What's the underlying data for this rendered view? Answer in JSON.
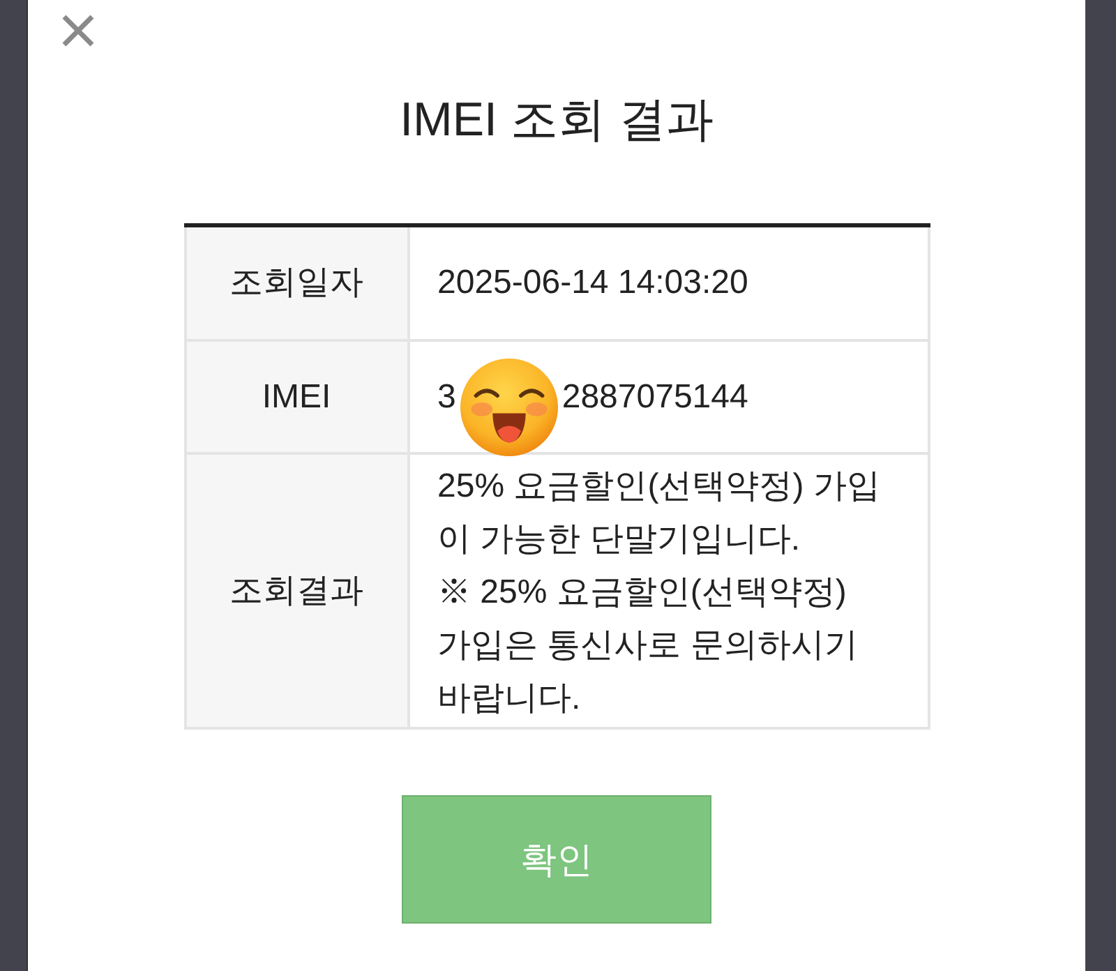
{
  "dialog": {
    "title": "IMEI 조회 결과",
    "table": {
      "rows": [
        {
          "kind": "text",
          "label": "조회일자",
          "value": "2025-06-14 14:03:20"
        },
        {
          "kind": "masked",
          "label": "IMEI",
          "value_start": "3",
          "value_end": "2887075144"
        },
        {
          "kind": "paragraphs",
          "label": "조회결과",
          "paragraphs": [
            "25% 요금할인(선택약정) 가입이 가능한 단말기입니다.",
            "※ 25% 요금할인(선택약정) 가입은 통신사로 문의하시기 바랍니다."
          ]
        }
      ]
    },
    "confirm_button": "확인"
  }
}
